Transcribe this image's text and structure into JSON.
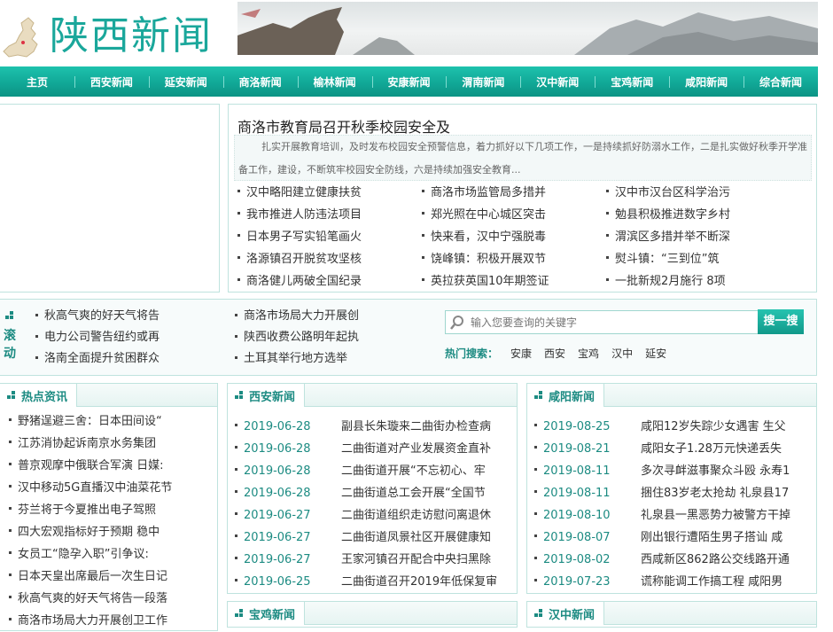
{
  "header": {
    "logo_text": "陕西新闻"
  },
  "nav": [
    "主页",
    "西安新闻",
    "延安新闻",
    "商洛新闻",
    "榆林新闻",
    "安康新闻",
    "渭南新闻",
    "汉中新闻",
    "宝鸡新闻",
    "咸阳新闻",
    "综合新闻"
  ],
  "headline": {
    "title": "商洛市教育局召开秋季校园安全及",
    "desc": "扎实开展教育培训，及时发布校园安全预警信息，着力抓好以下几项工作，一是持续抓好防溺水工作，二是扎实做好秋季开学准备工作，建设，不断筑牢校园安全防线，六是持续加强安全教育..."
  },
  "top_news": [
    [
      "汉中略阳建立健康扶贫",
      "商洛市场监管局多措并",
      "汉中市汉台区科学治污"
    ],
    [
      "我市推进人防违法项目",
      "郑光照在中心城区突击",
      "勉县积极推进数字乡村"
    ],
    [
      "日本男子写实铅笔画火",
      "快来看，汉中宁强脱毒",
      "渭滨区多措并举不断深"
    ],
    [
      "洛源镇召开脱贫攻坚核",
      "饶峰镇：积极开展双节",
      "熨斗镇：“三到位”筑"
    ],
    [
      "商洛健儿两破全国纪录",
      "英拉获英国10年期签证",
      "一批新规2月施行 8项"
    ]
  ],
  "scroll": {
    "label": "滚动",
    "col1": [
      "秋高气爽的好天气将告",
      "电力公司警告纽约或再",
      "洛南全面提升贫困群众"
    ],
    "col2": [
      "商洛市场局大力开展创",
      "陕西收费公路明年起执",
      "土耳其举行地方选举"
    ]
  },
  "search": {
    "placeholder": "输入您要查询的关键字",
    "button": "搜一搜",
    "hot_label": "热门搜索：",
    "hot": [
      "安康",
      "西安",
      "宝鸡",
      "汉中",
      "延安"
    ]
  },
  "hot_news": {
    "title": "热点资讯",
    "items": [
      "野猪逞避三舍：日本田间设“",
      "江苏消协起诉南京水务集团",
      "普京观摩中俄联合军演 日媒:",
      "汉中移动5G直播汉中油菜花节",
      "芬兰将于今夏推出电子驾照",
      "四大宏观指标好于预期 稳中",
      "女员工“隐孕入职”引争议:",
      "日本天皇出席最后一次生日记",
      "秋高气爽的好天气将告一段落",
      "商洛市场局大力开展创卫工作"
    ]
  },
  "xian": {
    "title": "西安新闻",
    "items": [
      {
        "date": "2019-06-28",
        "text": "副县长朱璇来二曲街办检查病"
      },
      {
        "date": "2019-06-28",
        "text": "二曲街道对产业发展资金直补"
      },
      {
        "date": "2019-06-28",
        "text": "二曲街道开展“不忘初心、牢"
      },
      {
        "date": "2019-06-28",
        "text": "二曲街道总工会开展“全国节"
      },
      {
        "date": "2019-06-27",
        "text": "二曲街道组织走访慰问离退休"
      },
      {
        "date": "2019-06-27",
        "text": "二曲街道凤景社区开展健康知"
      },
      {
        "date": "2019-06-27",
        "text": "王家河镇召开配合中央扫黑除"
      },
      {
        "date": "2019-06-25",
        "text": "二曲街道召开2019年低保复审"
      }
    ]
  },
  "xianyang": {
    "title": "咸阳新闻",
    "items": [
      {
        "date": "2019-08-25",
        "text": "咸阳12岁失踪少女遇害 生父"
      },
      {
        "date": "2019-08-21",
        "text": "咸阳女子1.28万元快递丢失"
      },
      {
        "date": "2019-08-11",
        "text": "多次寻衅滋事聚众斗殴 永寿1"
      },
      {
        "date": "2019-08-11",
        "text": "捆住83岁老太抢劫 礼泉县17"
      },
      {
        "date": "2019-08-10",
        "text": "礼泉县一黑恶势力被警方干掉"
      },
      {
        "date": "2019-08-07",
        "text": "刚出银行遭陌生男子搭讪 咸"
      },
      {
        "date": "2019-08-02",
        "text": "西咸新区862路公交线路开通"
      },
      {
        "date": "2019-07-23",
        "text": "谎称能调工作搞工程 咸阳男"
      }
    ]
  },
  "baoji": {
    "title": "宝鸡新闻"
  },
  "hanzhong": {
    "title": "汉中新闻"
  }
}
